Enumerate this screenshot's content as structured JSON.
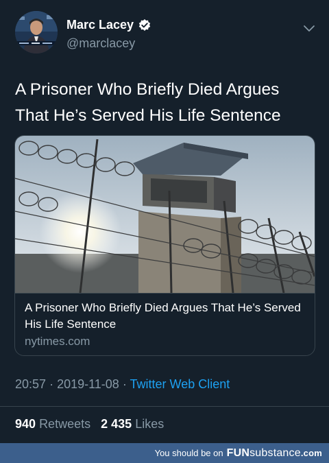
{
  "user": {
    "name": "Marc Lacey",
    "handle": "@marclacey"
  },
  "tweet": {
    "text": "A Prisoner Who Briefly Died Argues That He’s Served His Life Sentence"
  },
  "card": {
    "title": "A Prisoner Who Briefly Died Argues That He’s Served His Life Sentence",
    "domain": "nytimes.com"
  },
  "meta": {
    "time": "20:57",
    "sep": "·",
    "date": "2019-11-08",
    "client": "Twitter Web Client"
  },
  "stats": {
    "retweets_count": "940",
    "retweets_label": "Retweets",
    "likes_count": "2 435",
    "likes_label": "Likes"
  },
  "footer": {
    "prefix": "You should be on",
    "brand_bold": "FUN",
    "brand_light": "substance",
    "tld": ".com"
  },
  "colors": {
    "background": "#15202b",
    "accent": "#1da1f2",
    "secondary_text": "#8899a6",
    "footer_bar": "#3c5f8c"
  },
  "icons": {
    "verified": "verified-badge-icon",
    "chevron": "chevron-down-icon"
  }
}
